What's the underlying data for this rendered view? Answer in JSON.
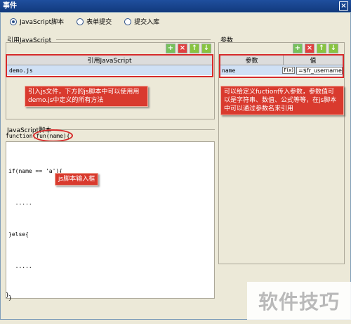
{
  "window": {
    "title": "事件",
    "close_glyph": "×"
  },
  "radios": [
    {
      "label": "JavaScript脚本",
      "selected": true
    },
    {
      "label": "表单提交",
      "selected": false
    },
    {
      "label": "提交入库",
      "selected": false
    }
  ],
  "js_ref": {
    "section_title": "引用JavaScript",
    "column_header": "引用JavaScript",
    "rows": [
      "demo.js"
    ],
    "callout": "引入js文件，下方的js脚本中可以使用用demo.js中定义的所有方法"
  },
  "params": {
    "section_title": "参数",
    "col_param": "参数",
    "col_value": "值",
    "row": {
      "name": "name",
      "fx": "F(x)",
      "value": "=$fr_username"
    },
    "callout": "可以给定义fuction传入参数，参数值可以是字符串、数值、公式等等，在js脚本中可以通过参数名来引用"
  },
  "toolbar": {
    "add": "+",
    "delete": "×",
    "up": "↑",
    "down": "↓"
  },
  "script": {
    "section_title": "JavaScript脚本",
    "signature_prefix": "function(",
    "signature_param": "fun(name)",
    "signature_suffix": "{",
    "lines": [
      "if(name == 'a'){",
      "  .....",
      "}else{",
      "  .....",
      "}"
    ],
    "closing": "}",
    "callout": "js脚本输入框"
  },
  "watermark": "软件技巧"
}
